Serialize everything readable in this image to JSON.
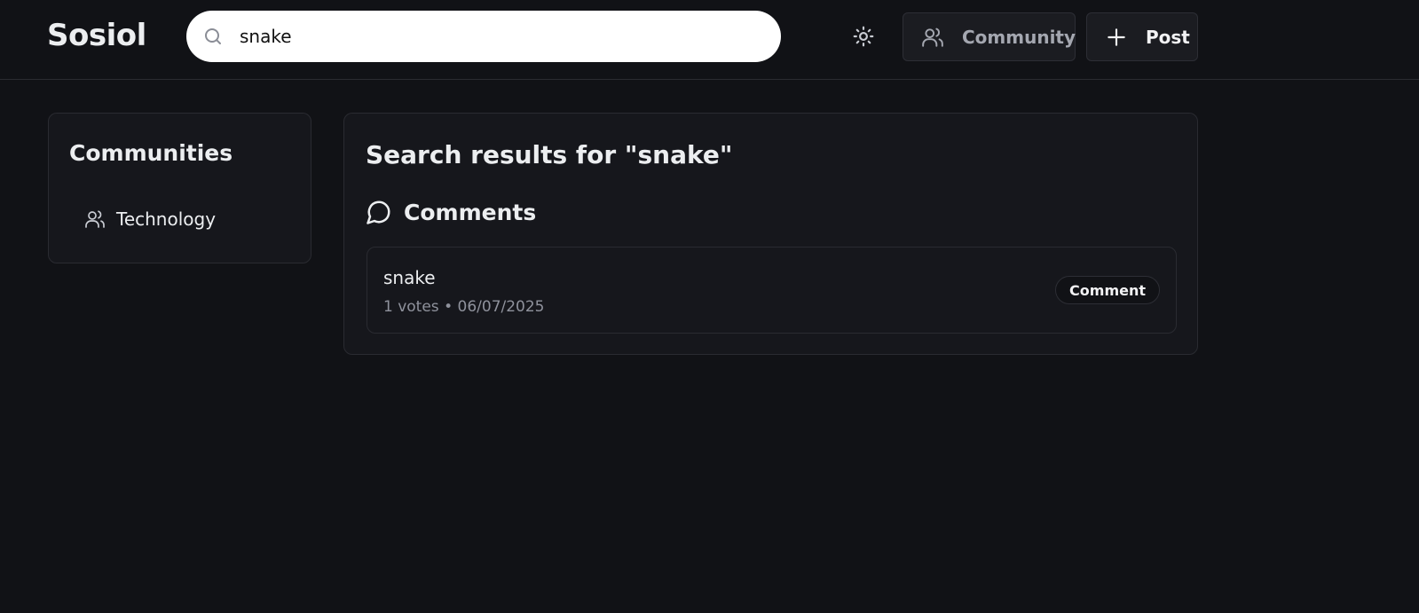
{
  "header": {
    "brand": "Sosiol",
    "search": {
      "value": "snake"
    },
    "community_button": "Community",
    "post_button": "Post"
  },
  "sidebar": {
    "title": "Communities",
    "items": [
      {
        "label": "Technology",
        "icon": "users-icon"
      }
    ]
  },
  "main": {
    "title": "Search results for \"snake\"",
    "sections": [
      {
        "label": "Comments",
        "icon": "message-circle-icon",
        "results": [
          {
            "text": "snake",
            "votes": "1 votes",
            "separator": "•",
            "date": "06/07/2025",
            "badge": "Comment"
          }
        ]
      }
    ]
  },
  "colors": {
    "background": "#111216",
    "panel": "#16171c",
    "border": "#2a2b31",
    "text": "#eceef0",
    "muted": "#8f929c"
  }
}
